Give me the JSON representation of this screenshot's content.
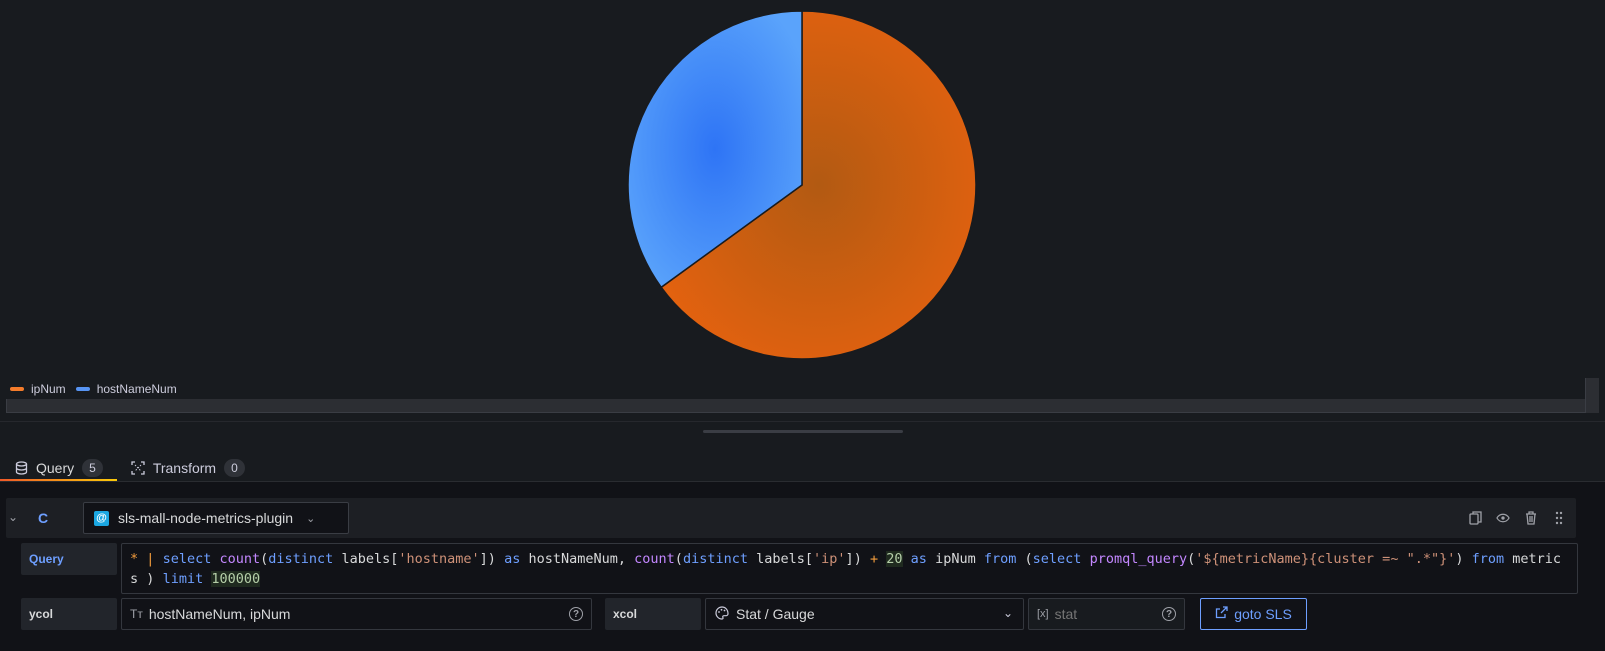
{
  "panel": {
    "chart_data": {
      "type": "pie",
      "series": [
        {
          "name": "ipNum",
          "value": 65
        },
        {
          "name": "hostNameNum",
          "value": 35
        }
      ],
      "colors": {
        "ipNum": "#e5620f",
        "hostNameNum": "#4e92f5"
      }
    },
    "legend": [
      {
        "label": "ipNum",
        "color": "#f47c2b"
      },
      {
        "label": "hostNameNum",
        "color": "#5794f2"
      }
    ]
  },
  "tabs": [
    {
      "label": "Query",
      "count": "5",
      "icon": "database-icon",
      "active": true
    },
    {
      "label": "Transform",
      "count": "0",
      "icon": "transform-icon",
      "active": false
    }
  ],
  "query_row": {
    "ref_id": "C",
    "datasource": "sls-mall-node-metrics-plugin",
    "query_label": "Query",
    "query_text": "* | select count(distinct labels['hostname']) as hostNameNum, count(distinct labels['ip']) + 20 as ipNum from (select promql_query('${metricName}{cluster =~ \".*\"}') from metrics ) limit 100000",
    "ycol_label": "ycol",
    "ycol_value": "hostNameNum, ipNum",
    "xcol_label": "xcol",
    "xcol_select": "Stat / Gauge",
    "xcol_input_placeholder": "stat",
    "goto_label": "goto SLS"
  }
}
